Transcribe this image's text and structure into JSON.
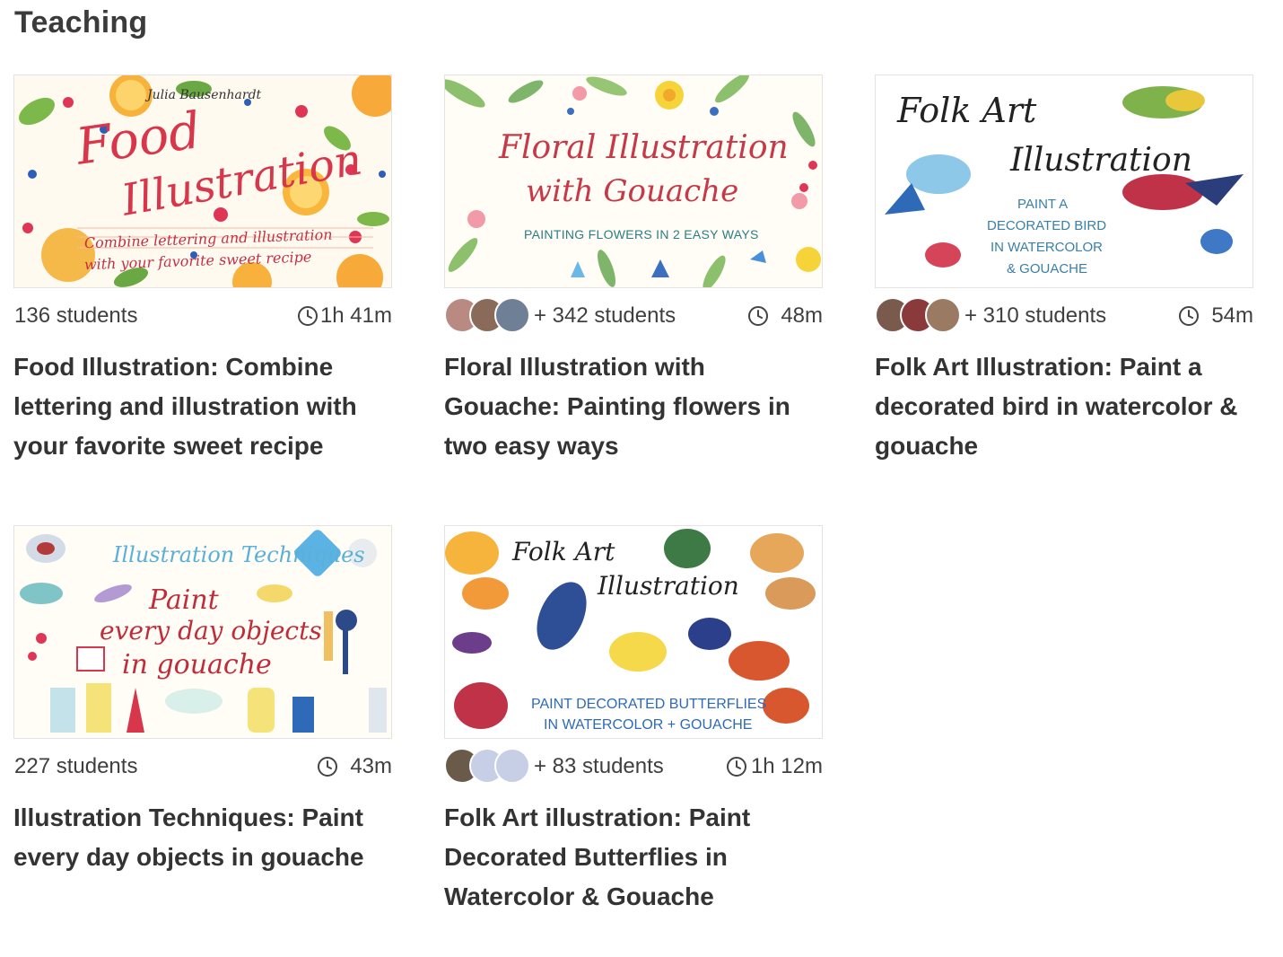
{
  "section": {
    "title": "Teaching"
  },
  "courses": [
    {
      "thumb": {
        "line1": "Julia Bausenhardt",
        "line2": "Food",
        "line3": "Illustration",
        "line4": "Combine lettering and illustration",
        "line5": "with your favorite sweet recipe"
      },
      "students": "136 students",
      "duration": "1h 41m",
      "title": "Food Illustration: Combine lettering and illustration with your favorite sweet recipe"
    },
    {
      "thumb": {
        "line1": "Floral Illustration",
        "line2": "with Gouache",
        "line3": "PAINTING FLOWERS IN 2 EASY WAYS"
      },
      "students": "+ 342 students",
      "duration": "48m",
      "title": "Floral Illustration with Gouache: Painting flowers in two easy ways"
    },
    {
      "thumb": {
        "line1": "Folk Art",
        "line2": "Illustration",
        "line3": "PAINT A",
        "line4": "DECORATED BIRD",
        "line5": "IN WATERCOLOR",
        "line6": "& GOUACHE"
      },
      "students": "+ 310 students",
      "duration": "54m",
      "title": "Folk Art Illustration: Paint a decorated bird in watercolor & gouache"
    },
    {
      "thumb": {
        "line1": "Illustration Techniques",
        "line2": "Paint",
        "line3": "every day objects",
        "line4": "in gouache"
      },
      "students": "227 students",
      "duration": "43m",
      "title": "Illustration Techniques: Paint every day objects in gouache"
    },
    {
      "thumb": {
        "line1": "Folk Art",
        "line2": "Illustration",
        "line3": "PAINT DECORATED BUTTERFLIES",
        "line4": "IN WATERCOLOR + GOUACHE"
      },
      "students": "+ 83 students",
      "duration": "1h 12m",
      "title": "Folk Art illustration: Paint Decorated Butterflies in Watercolor & Gouache"
    }
  ],
  "colors": {
    "accent_red": "#d8364a",
    "accent_blue": "#3f78c4",
    "accent_orange": "#f4a43b",
    "text": "#333333"
  },
  "icons": {
    "duration": "clock-icon"
  }
}
